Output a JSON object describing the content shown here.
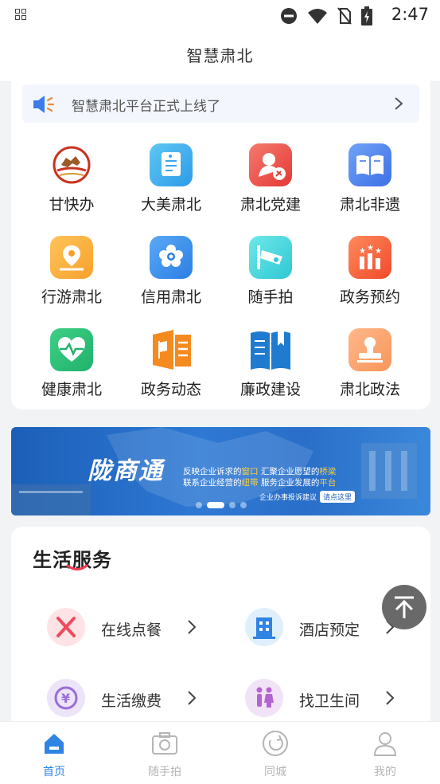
{
  "status": {
    "time": "2:47"
  },
  "header": {
    "title": "智慧肃北"
  },
  "notice": {
    "text": "智慧肃北平台正式上线了"
  },
  "apps": [
    {
      "label": "甘快办",
      "icon": "horse-logo-icon"
    },
    {
      "label": "大美肃北",
      "icon": "document-icon"
    },
    {
      "label": "肃北党建",
      "icon": "party-emblem-icon"
    },
    {
      "label": "肃北非遗",
      "icon": "open-book-icon"
    },
    {
      "label": "行游肃北",
      "icon": "map-pin-icon"
    },
    {
      "label": "信用肃北",
      "icon": "flower-icon"
    },
    {
      "label": "随手拍",
      "icon": "cctv-camera-icon"
    },
    {
      "label": "政务预约",
      "icon": "award-bars-icon"
    },
    {
      "label": "健康肃北",
      "icon": "heartbeat-icon"
    },
    {
      "label": "政务动态",
      "icon": "flag-news-icon"
    },
    {
      "label": "廉政建设",
      "icon": "book-blue-icon"
    },
    {
      "label": "肃北政法",
      "icon": "stamp-icon"
    }
  ],
  "banner": {
    "title": "陇商通",
    "line1_a": "反映企业诉求的",
    "line1_b": "窗口",
    "line1_c": "汇聚企业愿望的",
    "line1_d": "桥梁",
    "line2_a": "联系企业经营的",
    "line2_b": "纽带",
    "line2_c": "服务企业发展的",
    "line2_d": "平台",
    "pill_text": "企业办事投诉建议",
    "pill_btn": "请点这里"
  },
  "services": {
    "title": "生活服务",
    "items": [
      {
        "label": "在线点餐",
        "icon": "fork-knife-icon",
        "color": "#fde3e6"
      },
      {
        "label": "酒店预定",
        "icon": "hotel-building-icon",
        "color": "#dff0fb"
      },
      {
        "label": "生活缴费",
        "icon": "yuan-cycle-icon",
        "color": "#ece4f8"
      },
      {
        "label": "找卫生间",
        "icon": "restroom-icon",
        "color": "#f1e3f6"
      }
    ]
  },
  "tabs": [
    {
      "label": "首页",
      "icon": "home-icon",
      "active": true
    },
    {
      "label": "随手拍",
      "icon": "camera-icon",
      "active": false
    },
    {
      "label": "同城",
      "icon": "circle-arrow-icon",
      "active": false
    },
    {
      "label": "我的",
      "icon": "user-icon",
      "active": false
    }
  ],
  "colors": {
    "accent": "#2f84e4"
  }
}
